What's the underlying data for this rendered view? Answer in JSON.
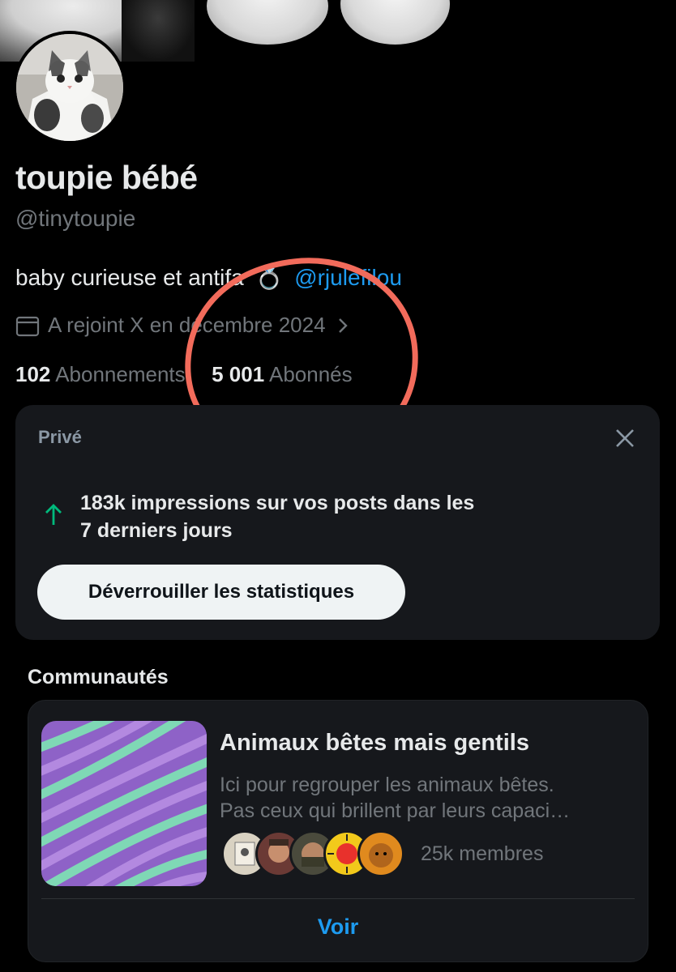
{
  "profile": {
    "display_name": "toupie bébé",
    "handle": "@tinytoupie",
    "bio_text": "baby curieuse et antifa",
    "bio_emoji": "💍",
    "bio_mention": "@rjulefilou",
    "joined": "A rejoint X en décembre 2024",
    "following_count": "102",
    "following_label": "Abonnements",
    "followers_count": "5 001",
    "followers_label": "Abonnés"
  },
  "insights_card": {
    "label": "Privé",
    "impressions_line1": "183k impressions sur vos posts dans les",
    "impressions_line2": "7 derniers jours",
    "unlock_button": "Déverrouiller les statistiques"
  },
  "communities": {
    "section_title": "Communautés",
    "items": [
      {
        "name": "Animaux bêtes mais gentils",
        "description_line1": "Ici pour regrouper les animaux bêtes.",
        "description_line2": "Pas ceux qui brillent par leurs capaci…",
        "members": "25k membres",
        "action": "Voir"
      }
    ]
  },
  "icons": [
    "calendar-icon",
    "chevron-right-icon",
    "close-icon",
    "arrow-up-icon"
  ],
  "colors": {
    "background": "#000000",
    "card": "#16181c",
    "link": "#1d9bf0",
    "muted": "#71767b",
    "trend_up": "#00ba7c",
    "annotation_circle": "#f26b5b"
  }
}
